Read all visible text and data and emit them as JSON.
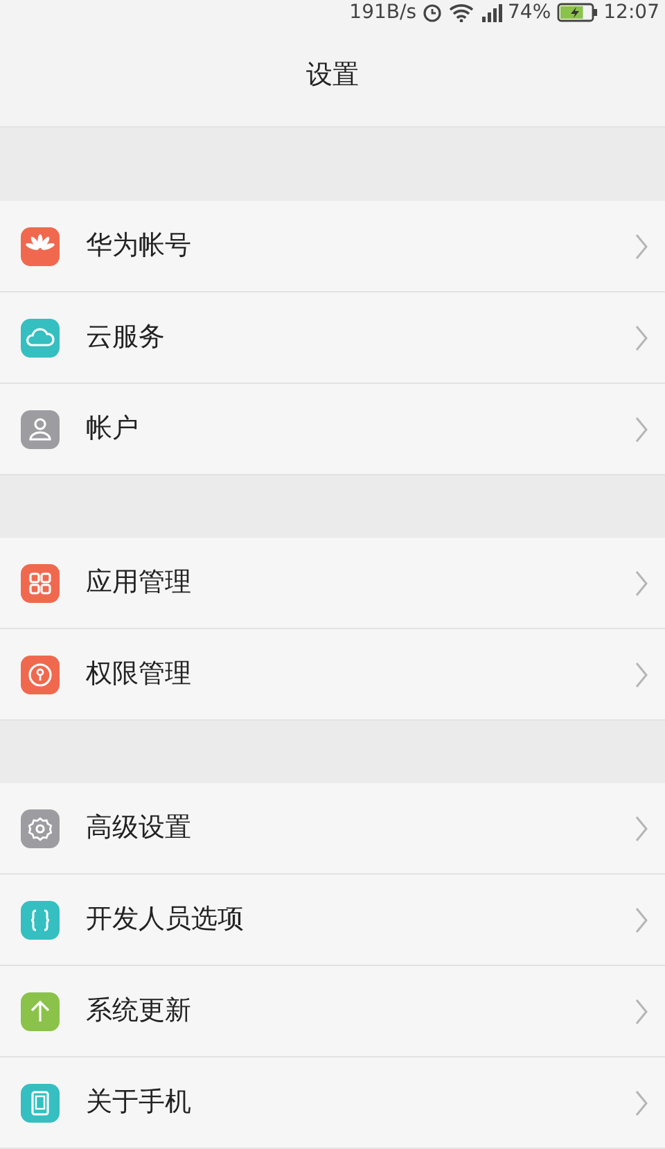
{
  "status_bar": {
    "speed": "191B/s",
    "battery_percent": "74%",
    "charging": true,
    "time": "12:07"
  },
  "title": "设置",
  "groups": [
    {
      "items": [
        {
          "label": "华为帐号",
          "kind": "petals",
          "color": "#f0694f"
        },
        {
          "label": "云服务",
          "kind": "cloud",
          "color": "#35bfc1"
        },
        {
          "label": "帐户",
          "kind": "person",
          "color": "#9c9ca1"
        }
      ]
    },
    {
      "items": [
        {
          "label": "应用管理",
          "kind": "grid",
          "color": "#f0694f"
        },
        {
          "label": "权限管理",
          "kind": "keyhole",
          "color": "#f0694f"
        }
      ]
    },
    {
      "items": [
        {
          "label": "高级设置",
          "kind": "gear",
          "color": "#9c9ca1"
        },
        {
          "label": "开发人员选项",
          "kind": "braces",
          "color": "#35bfc1"
        },
        {
          "label": "系统更新",
          "kind": "arrow",
          "color": "#8bc34a"
        },
        {
          "label": "关于手机",
          "kind": "phone",
          "color": "#35bfc1"
        }
      ]
    }
  ]
}
